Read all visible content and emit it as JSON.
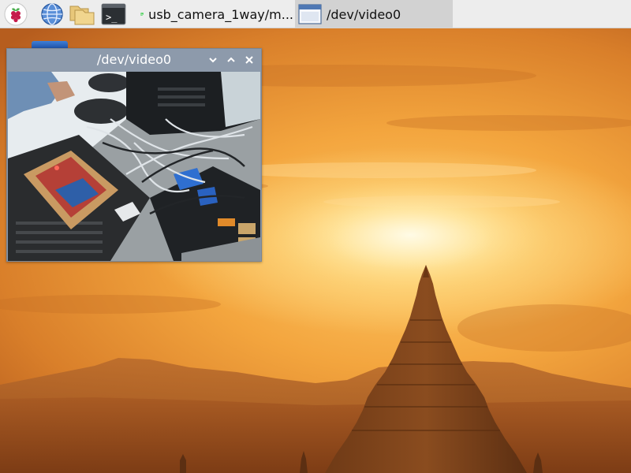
{
  "taskbar": {
    "launchers": [
      {
        "name": "raspberry-menu-icon"
      },
      {
        "name": "web-browser-icon"
      },
      {
        "name": "file-manager-icon"
      },
      {
        "name": "terminal-icon"
      }
    ],
    "tasks": [
      {
        "label": "usb_camera_1way/m...",
        "icon": "qt-icon",
        "badge": "Qt",
        "active": false
      },
      {
        "label": "/dev/video0",
        "icon": "window-icon",
        "active": true
      }
    ],
    "terminal_glyph": ">_"
  },
  "window": {
    "title": "/dev/video0",
    "controls": [
      "minimize-icon",
      "maximize-icon",
      "close-icon"
    ]
  },
  "colors": {
    "taskbar_bg": "#ededed",
    "titlebar_bg": "#8d9aab",
    "sky_bright": "#fff6d6",
    "sky_orange": "#f3a53e"
  }
}
